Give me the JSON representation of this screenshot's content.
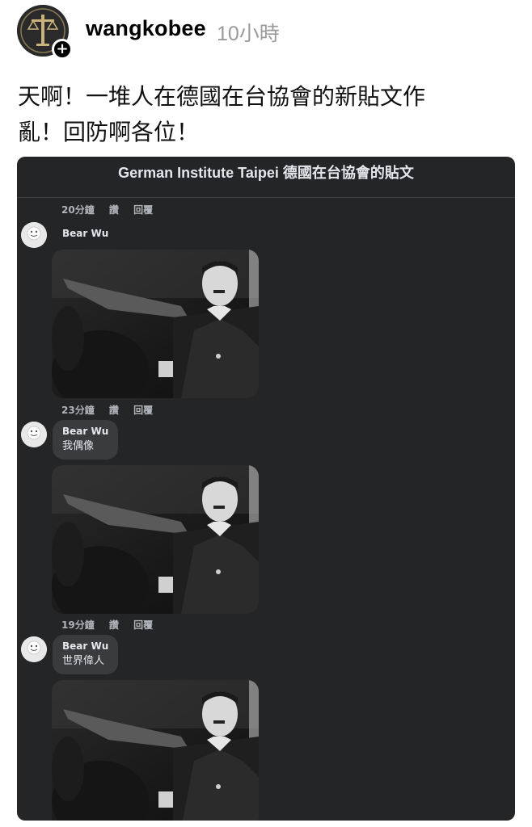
{
  "post": {
    "username": "wangkobee",
    "timestamp": "10小時",
    "text_line1": "天啊！一堆人在德國在台協會的新貼文作",
    "text_line2": "亂！回防啊各位！",
    "avatar_icon": "logo-avatar",
    "follow_icon": "plus-icon"
  },
  "screenshot": {
    "title": "German Institute Taipei 德國在台協會的貼文",
    "comments": [
      {
        "meta": {
          "time": "20分鐘",
          "like": "讚",
          "reply": "回覆"
        }
      },
      {
        "name": "Bear Wu",
        "text": "",
        "has_image": true,
        "meta": {
          "time": "23分鐘",
          "like": "讚",
          "reply": "回覆"
        }
      },
      {
        "name": "Bear Wu",
        "text": "我偶像",
        "has_image": true,
        "meta": {
          "time": "19分鐘",
          "like": "讚",
          "reply": "回覆"
        }
      },
      {
        "name": "Bear Wu",
        "text": "世界偉人",
        "has_image": true
      }
    ]
  },
  "colors": {
    "card_bg": "#242526",
    "bubble_bg": "#3a3b3c",
    "meta_text": "#b0b3b8",
    "timestamp": "#9a9a9a"
  }
}
